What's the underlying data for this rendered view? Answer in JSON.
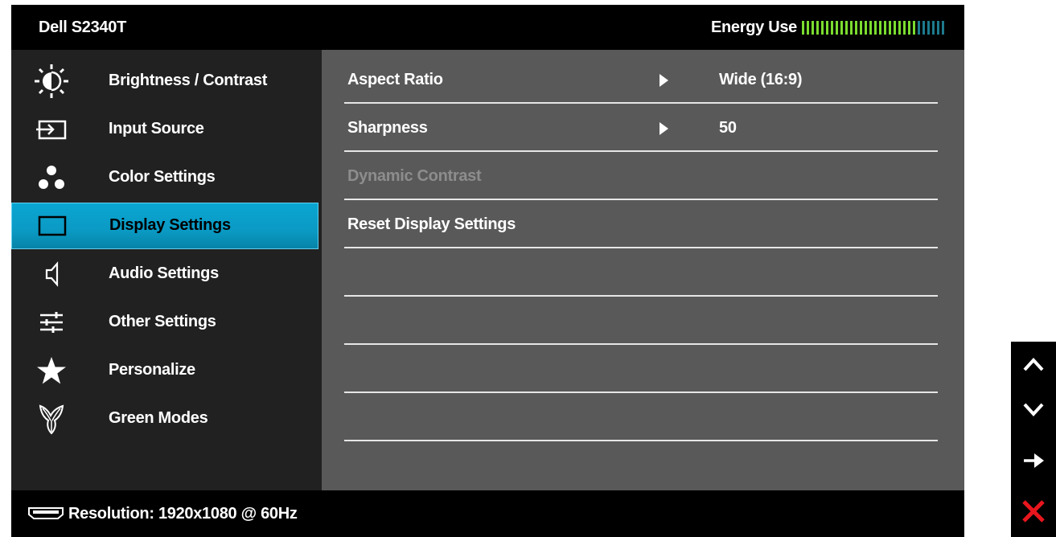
{
  "window": {
    "title": "Dell S2340T"
  },
  "energy": {
    "label": "Energy Use",
    "total_segments": 30,
    "active_segments": 24,
    "active_color": "#7bdc2f",
    "inactive_color": "#1d7a8e"
  },
  "menu": {
    "selected_color": "#0a9ac4",
    "items": [
      {
        "label": "Brightness / Contrast",
        "icon": "brightness-icon",
        "selected": false
      },
      {
        "label": "Input Source",
        "icon": "input-source-icon",
        "selected": false
      },
      {
        "label": "Color Settings",
        "icon": "color-settings-icon",
        "selected": false
      },
      {
        "label": "Display Settings",
        "icon": "display-icon",
        "selected": true
      },
      {
        "label": "Audio Settings",
        "icon": "speaker-icon",
        "selected": false
      },
      {
        "label": "Other Settings",
        "icon": "sliders-icon",
        "selected": false
      },
      {
        "label": "Personalize",
        "icon": "star-icon",
        "selected": false
      },
      {
        "label": "Green Modes",
        "icon": "leaf-icon",
        "selected": false
      }
    ]
  },
  "display_settings": {
    "rows": [
      {
        "name": "Aspect Ratio",
        "value": "Wide (16:9)",
        "has_submenu": true,
        "enabled": true
      },
      {
        "name": "Sharpness",
        "value": "50",
        "has_submenu": true,
        "enabled": true
      },
      {
        "name": "Dynamic Contrast",
        "value": "",
        "has_submenu": false,
        "enabled": false
      },
      {
        "name": "Reset Display Settings",
        "value": "",
        "has_submenu": false,
        "enabled": true
      },
      {
        "name": "",
        "value": "",
        "has_submenu": false,
        "enabled": true
      },
      {
        "name": "",
        "value": "",
        "has_submenu": false,
        "enabled": true
      },
      {
        "name": "",
        "value": "",
        "has_submenu": false,
        "enabled": true
      },
      {
        "name": "",
        "value": "",
        "has_submenu": false,
        "enabled": true
      }
    ]
  },
  "status": {
    "resolution_text": "Resolution: 1920x1080 @ 60Hz",
    "icon": "hdmi-connector-icon"
  },
  "hardware_buttons": [
    {
      "icon": "chevron-up-icon"
    },
    {
      "icon": "chevron-down-icon"
    },
    {
      "icon": "arrow-right-icon"
    },
    {
      "icon": "close-icon",
      "color": "#e8161d"
    }
  ]
}
